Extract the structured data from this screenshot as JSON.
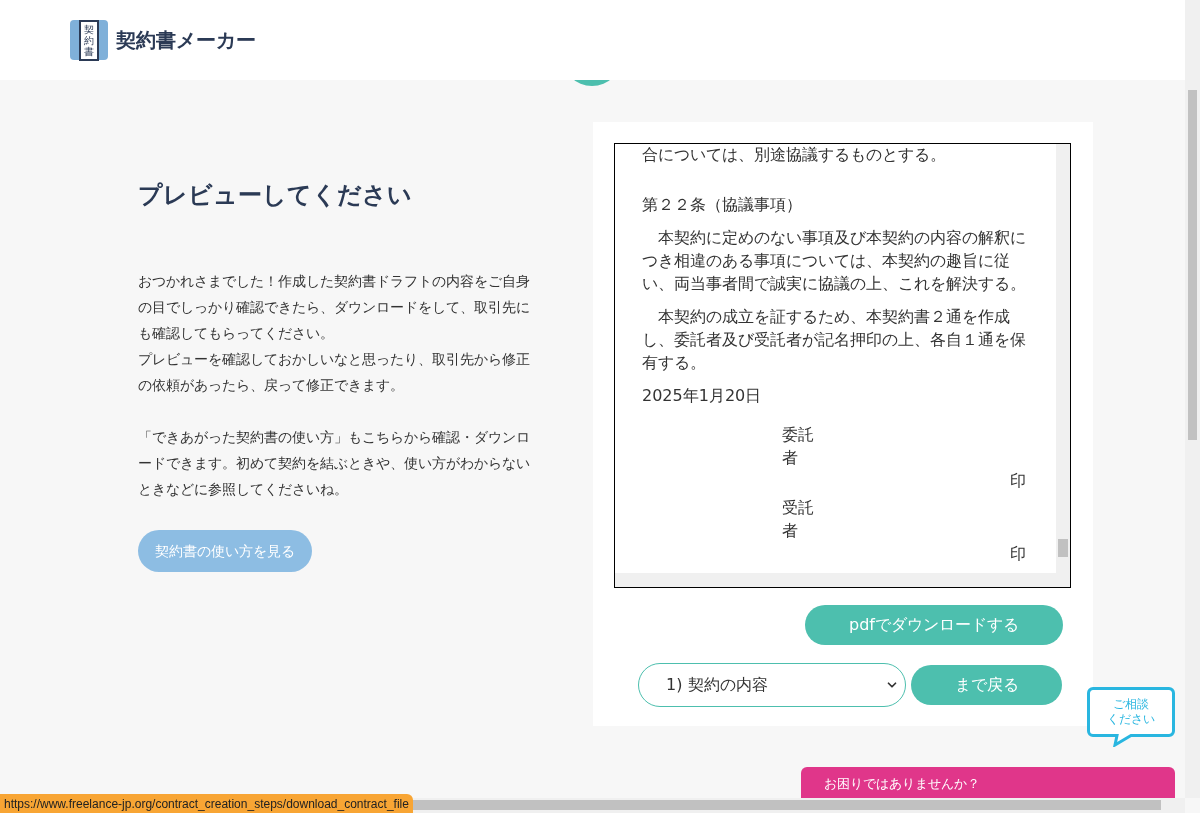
{
  "header": {
    "logo_badge": "契約書",
    "brand": "契約書メーカー"
  },
  "intro": {
    "title": "プレビューしてください",
    "paragraphs": [
      [
        "おつかれさまでした！作成した契約書ドラフトの内容をご自身の目でしっかり確認できたら、ダウンロードをして、取引先にも確認してもらってください。",
        "プレビューを確認しておかしいなと思ったり、取引先から修正の依頼があったら、戻って修正できます。"
      ],
      [
        "「できあがった契約書の使い方」もこちらから確認・ダウンロードできます。初めて契約を結ぶときや、使い方がわからないときなどに参照してくださいね。"
      ]
    ],
    "guide_button": "契約書の使い方を見る"
  },
  "preview": {
    "blocks": [
      {
        "kind": "text",
        "text": "合については、別途協議するものとする。"
      },
      {
        "kind": "heading",
        "text": "第２２条（協議事項）"
      },
      {
        "kind": "paragraph",
        "text": "本契約に定めのない事項及び本契約の内容の解釈につき相違のある事項については、本契約の趣旨に従い、両当事者間で誠実に協議の上、これを解決する。"
      },
      {
        "kind": "paragraph",
        "text": "本契約の成立を証するため、本契約書２通を作成し、委託者及び受託者が記名押印の上、各自１通を保有する。"
      },
      {
        "kind": "text",
        "text": "2025年1月20日"
      },
      {
        "kind": "signature",
        "party": "委託者",
        "seal": "印"
      },
      {
        "kind": "signature",
        "party": "受託者",
        "seal": "印"
      }
    ]
  },
  "download_button": "pdfでダウンロードする",
  "step_select": {
    "value": "1) 契約の内容"
  },
  "back_button": "まで戻る",
  "consult_bubble": [
    "ご相談",
    "ください"
  ],
  "help_bar": "お困りではありませんか？",
  "status_url": "https://www.freelance-jp.org/contract_creation_steps/download_contract_file"
}
